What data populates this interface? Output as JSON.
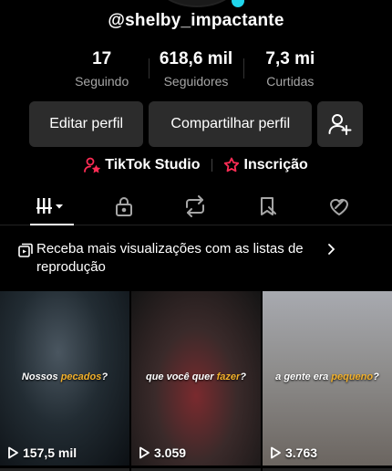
{
  "profile": {
    "username": "@shelby_impactante"
  },
  "stats": [
    {
      "value": "17",
      "label": "Seguindo"
    },
    {
      "value": "618,6 mil",
      "label": "Seguidores"
    },
    {
      "value": "7,3 mi",
      "label": "Curtidas"
    }
  ],
  "actions": {
    "edit_label": "Editar perfil",
    "share_label": "Compartilhar perfil"
  },
  "links": {
    "studio_label": "TikTok Studio",
    "subscription_label": "Inscrição"
  },
  "tabs": [
    {
      "icon": "videos-grid-icon",
      "active": true
    },
    {
      "icon": "lock-icon",
      "active": false
    },
    {
      "icon": "repost-icon",
      "active": false
    },
    {
      "icon": "favorites-icon",
      "active": false
    },
    {
      "icon": "liked-icon",
      "active": false
    }
  ],
  "playlist_banner": {
    "text": "Receba mais visualizações com as listas de reprodução"
  },
  "videos": [
    {
      "caption_pre": "Nossos ",
      "caption_hl": "pecados",
      "caption_post": "?",
      "views": "157,5 mil"
    },
    {
      "caption_pre": "que você quer ",
      "caption_hl": "fazer",
      "caption_post": "?",
      "views": "3.059"
    },
    {
      "caption_pre": "a gente era ",
      "caption_hl": "pequeno",
      "caption_post": "?",
      "views": "3.763"
    }
  ],
  "colors": {
    "background": "#000000",
    "button": "#2c2c2c",
    "accent_red": "#fe2c55",
    "caption_highlight": "#f3b12b"
  }
}
